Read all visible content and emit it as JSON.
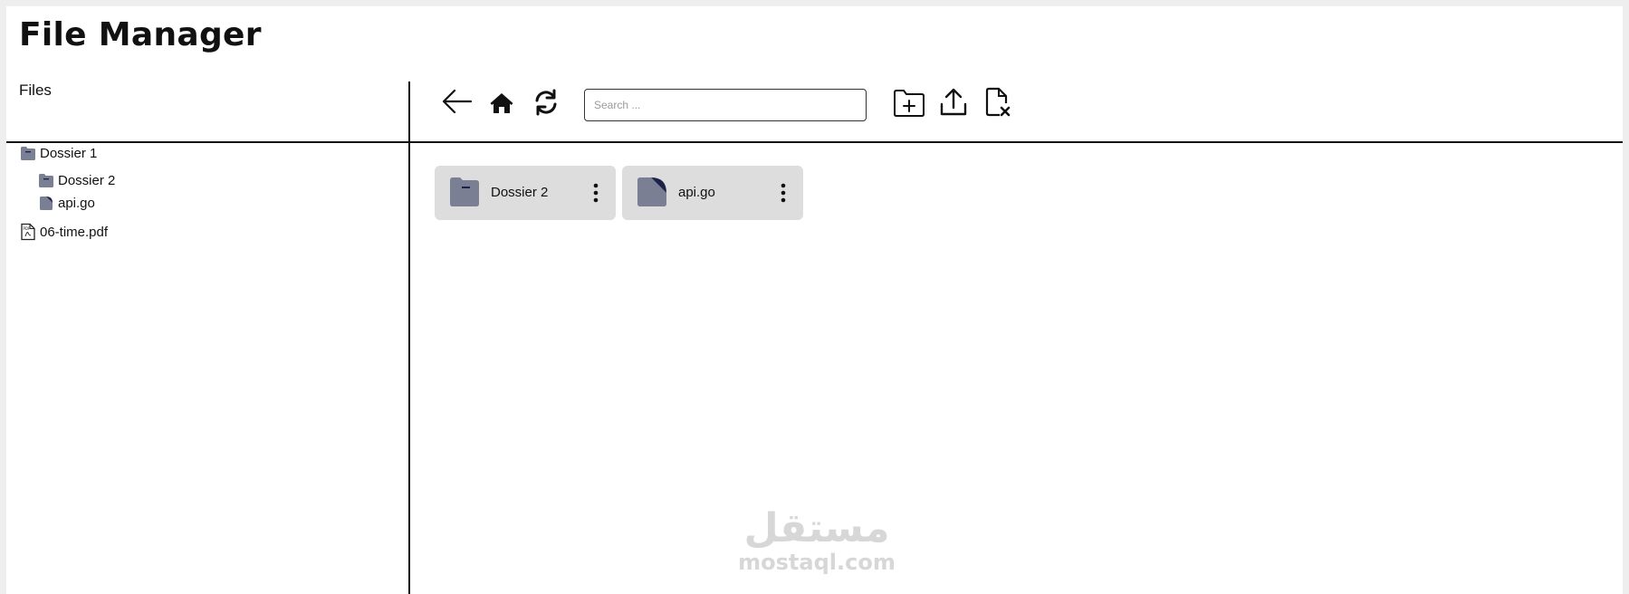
{
  "app": {
    "title": "File Manager"
  },
  "sidebar": {
    "header": "Files",
    "tree": [
      {
        "label": "Dossier 1",
        "icon": "folder-icon",
        "level": 0
      },
      {
        "label": "Dossier 2",
        "icon": "folder-icon",
        "level": 1
      },
      {
        "label": "api.go",
        "icon": "file-icon",
        "level": 1
      },
      {
        "label": "06-time.pdf",
        "icon": "pdf-file-icon",
        "level": 0
      }
    ]
  },
  "toolbar": {
    "back_icon": "arrow-left-icon",
    "home_icon": "home-icon",
    "refresh_icon": "refresh-icon",
    "search_placeholder": "Search ...",
    "search_value": "",
    "new_folder_icon": "folder-plus-icon",
    "upload_icon": "upload-icon",
    "delete_file_icon": "file-delete-icon"
  },
  "main": {
    "items": [
      {
        "label": "Dossier 2",
        "icon": "folder-icon"
      },
      {
        "label": "api.go",
        "icon": "file-icon"
      }
    ]
  },
  "watermark": {
    "arabic": "مستقل",
    "latin": "mostaql.com"
  },
  "colors": {
    "icon_fill": "#7b7f93",
    "icon_accent": "#1d2346",
    "card_bg": "#dddddd",
    "divider": "#111111"
  }
}
